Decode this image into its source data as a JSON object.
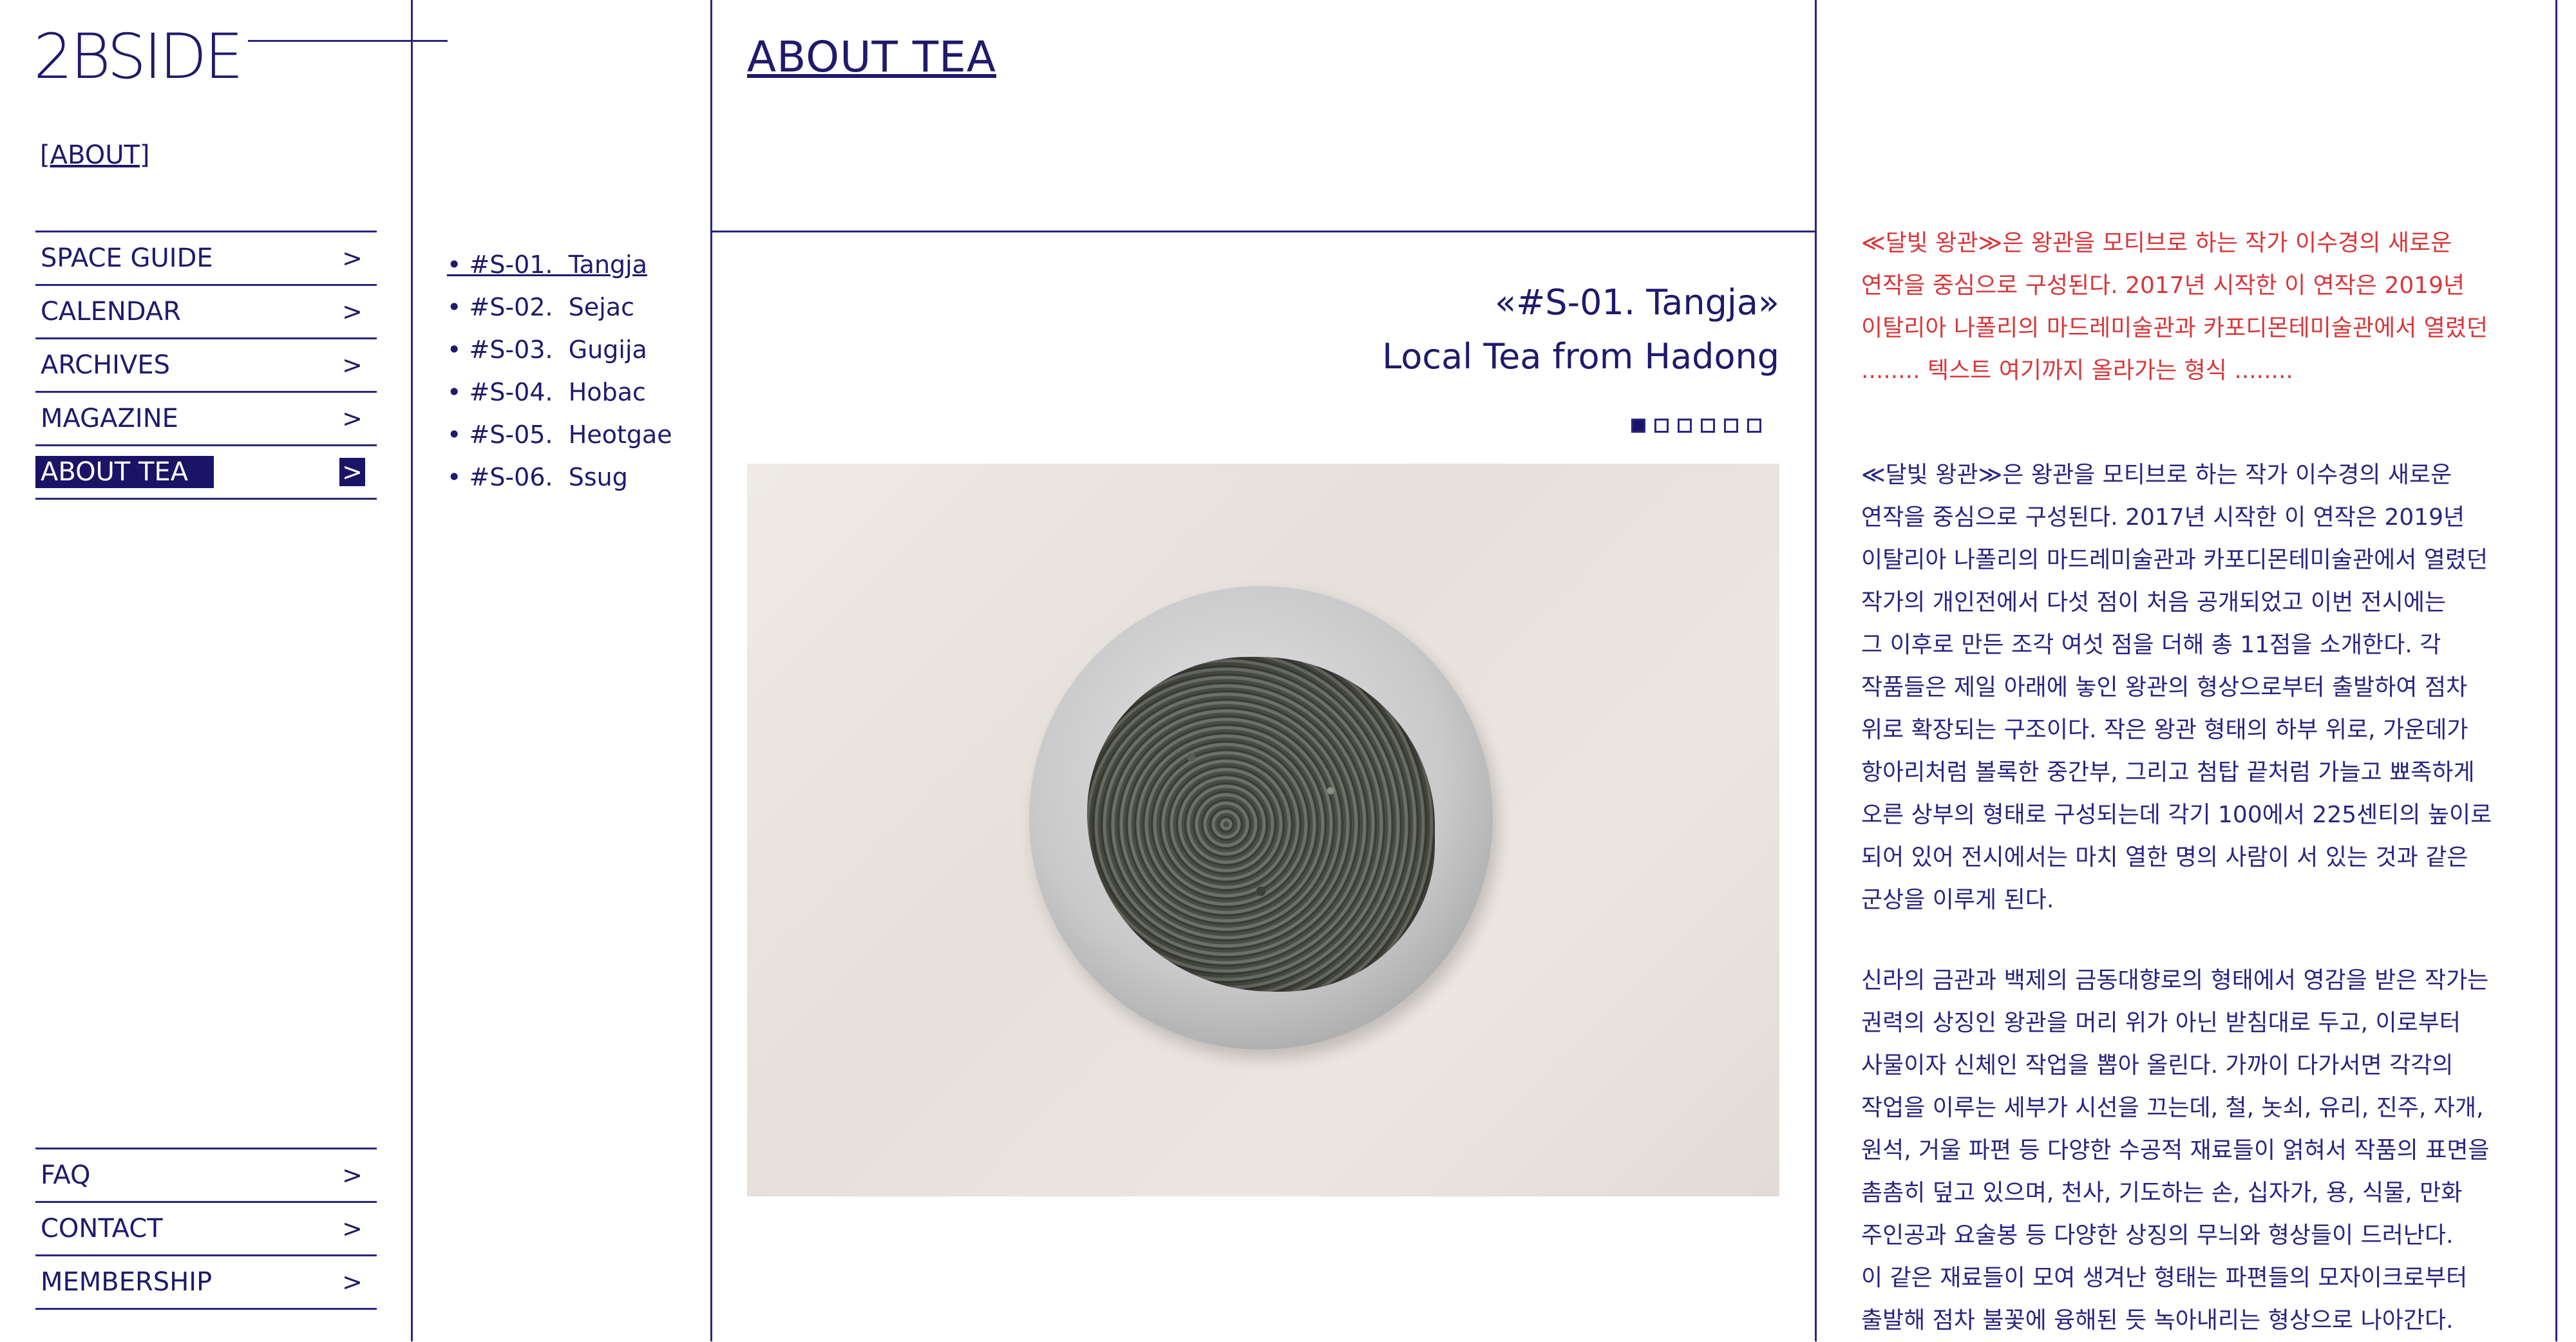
{
  "brand": {
    "logo": "2BSIDE",
    "about_link": "[ABOUT]"
  },
  "nav_top": [
    {
      "label": "SPACE GUIDE",
      "chevron": ">"
    },
    {
      "label": "CALENDAR",
      "chevron": ">"
    },
    {
      "label": "ARCHIVES",
      "chevron": ">"
    },
    {
      "label": "MAGAZINE",
      "chevron": ">"
    },
    {
      "label": "ABOUT TEA",
      "chevron": ">"
    }
  ],
  "nav_bottom": [
    {
      "label": "FAQ",
      "chevron": ">"
    },
    {
      "label": "CONTACT",
      "chevron": ">"
    },
    {
      "label": "MEMBERSHIP",
      "chevron": ">"
    }
  ],
  "tea_list": [
    "• #S-01.  Tangja",
    "• #S-02.  Sejac",
    "• #S-03.  Gugija",
    "• #S-04.  Hobac",
    "• #S-05.  Heotgae",
    "• #S-06.  Ssug"
  ],
  "main": {
    "section_title": "ABOUT TEA",
    "tea_title_line1": "«#S-01. Tangja»",
    "tea_title_line2": "Local Tea from Hadong",
    "slide_count": 6,
    "active_slide": 1
  },
  "right_text": {
    "red_lines": [
      "≪달빛 왕관≫은 왕관을 모티브로 하는 작가 이수경의 새로운",
      "연작을 중심으로 구성된다. 2017년 시작한 이 연작은 2019년",
      "이탈리아 나폴리의 마드레미술관과 카포디몬테미술관에서 열렸던",
      "........ 텍스트 여기까지 올라가는 형식 ........"
    ],
    "para1_lines": [
      "≪달빛 왕관≫은 왕관을 모티브로 하는 작가 이수경의 새로운",
      "연작을 중심으로 구성된다. 2017년 시작한 이 연작은 2019년",
      "이탈리아 나폴리의 마드레미술관과 카포디몬테미술관에서 열렸던",
      "작가의 개인전에서 다섯 점이 처음 공개되었고 이번 전시에는",
      "그 이후로 만든 조각 여섯 점을 더해 총 11점을 소개한다. 각",
      "작품들은 제일 아래에 놓인 왕관의 형상으로부터 출발하여 점차",
      "위로 확장되는 구조이다. 작은 왕관 형태의 하부 위로, 가운데가",
      "항아리처럼 볼록한 중간부, 그리고 첨탑 끝처럼 가늘고 뾰족하게",
      "오른 상부의 형태로 구성되는데 각기 100에서 225센티의 높이로",
      "되어 있어 전시에서는 마치 열한 명의 사람이 서 있는 것과 같은",
      "군상을 이루게 된다."
    ],
    "para2_lines": [
      "신라의 금관과 백제의 금동대향로의 형태에서 영감을 받은 작가는",
      "권력의 상징인 왕관을 머리 위가 아닌 받침대로 두고, 이로부터",
      "사물이자 신체인 작업을 뽑아 올린다. 가까이 다가서면 각각의",
      "작업을 이루는 세부가 시선을 끄는데, 철, 놋쇠, 유리, 진주, 자개,",
      "원석, 거울 파편 등 다양한 수공적 재료들이 얽혀서 작품의 표면을",
      "촘촘히 덮고 있으며, 천사, 기도하는 손, 십자가, 용, 식물, 만화",
      "주인공과 요술봉 등 다양한 상징의 무늬와 형상들이 드러난다.",
      "이 같은 재료들이 모여 생겨난 형태는 파편들의 모자이크로부터",
      "출발해 점차 불꽃에 융해된 듯 녹아내리는 형상으로 나아간다."
    ]
  },
  "colors": {
    "accent": "#1f1a6b",
    "highlight": "#d8373a"
  }
}
